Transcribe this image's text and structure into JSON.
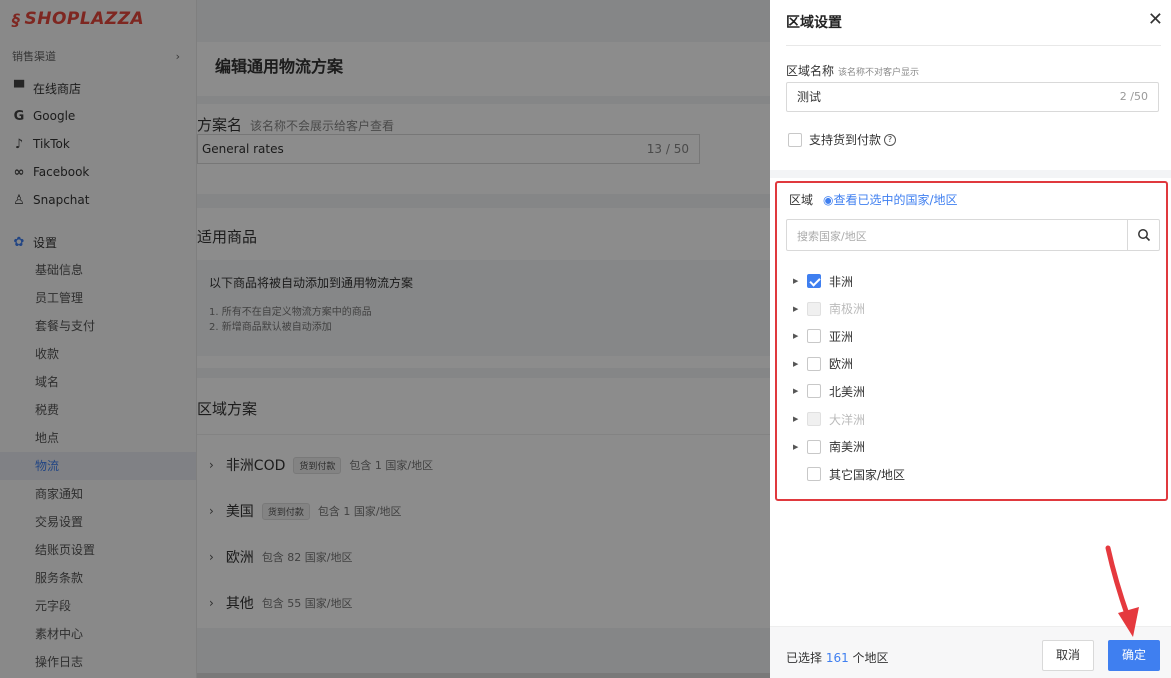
{
  "brand": {
    "logo": "SHOPLAZZA"
  },
  "sidebar": {
    "section": "销售渠道",
    "channels": [
      {
        "label": "在线商店",
        "icon": "store-icon",
        "glyph": "▀"
      },
      {
        "label": "Google",
        "icon": "google-icon",
        "glyph": "G"
      },
      {
        "label": "TikTok",
        "icon": "tiktok-icon",
        "glyph": "♪"
      },
      {
        "label": "Facebook",
        "icon": "meta-icon",
        "glyph": "∞"
      },
      {
        "label": "Snapchat",
        "icon": "snapchat-icon",
        "glyph": "♙"
      }
    ],
    "settings": {
      "label": "设置",
      "icon": "gear-icon"
    },
    "items": [
      "基础信息",
      "员工管理",
      "套餐与支付",
      "收款",
      "域名",
      "税费",
      "地点",
      "物流",
      "商家通知",
      "交易设置",
      "结账页设置",
      "服务条款",
      "元字段",
      "素材中心",
      "操作日志"
    ],
    "active": "物流"
  },
  "main": {
    "title": "编辑通用物流方案",
    "plan": {
      "label": "方案名",
      "hint": "该名称不会展示给客户查看",
      "value": "General rates",
      "count": "13 / 50"
    },
    "products": {
      "title": "适用商品",
      "desc": "以下商品将被自动添加到通用物流方案",
      "lines": [
        "1. 所有不在自定义物流方案中的商品",
        "2. 新增商品默认被自动添加"
      ]
    },
    "zones": {
      "title": "区域方案",
      "rows": [
        {
          "name": "非洲COD",
          "tag": "货到付款",
          "desc": "包含 1 国家/地区"
        },
        {
          "name": "美国",
          "tag": "货到付款",
          "desc": "包含 1 国家/地区"
        },
        {
          "name": "欧洲",
          "tag": "",
          "desc": "包含 82 国家/地区"
        },
        {
          "name": "其他",
          "tag": "",
          "desc": "包含 55 国家/地区"
        }
      ]
    }
  },
  "drawer": {
    "title": "区域设置",
    "name_label": "区域名称",
    "name_hint": "该名称不对客户显示",
    "name_value": "测试",
    "name_count": "2 /50",
    "cod_label": "支持货到付款",
    "region_label": "区域",
    "view_selected": "查看已选中的国家/地区",
    "search_placeholder": "搜索国家/地区",
    "tree": [
      {
        "label": "非洲",
        "state": "checked",
        "expandable": true
      },
      {
        "label": "南极洲",
        "state": "disabled",
        "expandable": true
      },
      {
        "label": "亚洲",
        "state": "unchecked",
        "expandable": true
      },
      {
        "label": "欧洲",
        "state": "unchecked",
        "expandable": true
      },
      {
        "label": "北美洲",
        "state": "unchecked",
        "expandable": true
      },
      {
        "label": "大洋洲",
        "state": "disabled",
        "expandable": true
      },
      {
        "label": "南美洲",
        "state": "unchecked",
        "expandable": true
      },
      {
        "label": "其它国家/地区",
        "state": "unchecked",
        "expandable": false
      }
    ],
    "footer": {
      "selected_prefix": "已选择 ",
      "selected_count": "161",
      "selected_suffix": " 个地区",
      "cancel": "取消",
      "ok": "确定"
    }
  },
  "colors": {
    "accent": "#3f7ff0",
    "highlight": "#e0393e",
    "brand": "#e5483c"
  }
}
